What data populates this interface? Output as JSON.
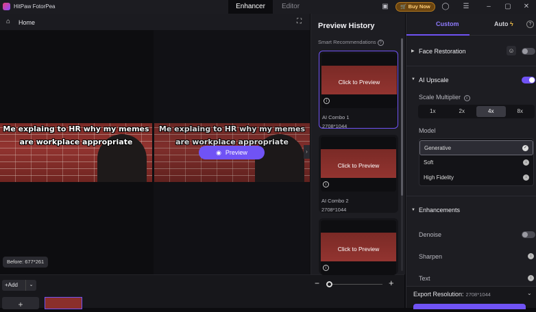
{
  "titlebar": {
    "app_name": "HitPaw FotorPea",
    "tabs": [
      "Enhancer",
      "Editor"
    ],
    "buy_now": "Buy Now",
    "icons": [
      "gift-icon",
      "user-icon",
      "menu-icon",
      "minimize-icon",
      "maximize-icon",
      "close-icon"
    ]
  },
  "home": {
    "label": "Home"
  },
  "canvas": {
    "meme_line1": "Me explaing to HR why my memes",
    "meme_line2": "are workplace appropriate",
    "preview_label": "Preview",
    "before_label": "Before: 677*261"
  },
  "bottom": {
    "add_label": "Add",
    "add_tile": "+"
  },
  "history": {
    "title": "Preview History",
    "smart_recommendations": "Smart Recommendations",
    "cards": [
      {
        "cta": "Click to Preview",
        "name": "AI Combo 1",
        "resolution": "2708*1044",
        "selected": true
      },
      {
        "cta": "Click to Preview",
        "name": "AI Combo 2",
        "resolution": "2708*1044",
        "selected": false
      },
      {
        "cta": "Click to Preview",
        "name": "",
        "resolution": "",
        "selected": false
      }
    ]
  },
  "panel": {
    "tab_custom": "Custom",
    "tab_auto": "Auto",
    "face_restoration": "Face Restoration",
    "ai_upscale": "AI Upscale",
    "scale_multiplier": "Scale Multiplier",
    "scale_options": [
      "1x",
      "2x",
      "4x",
      "8x"
    ],
    "scale_selected": "4x",
    "model_label": "Model",
    "models": [
      "Generative",
      "Soft",
      "High Fidelity"
    ],
    "model_selected": "Generative",
    "enhancements": "Enhancements",
    "denoise": "Denoise",
    "sharpen": "Sharpen",
    "text": "Text",
    "export_label": "Export Resolution:",
    "export_value": "2708*1044"
  },
  "colors": {
    "accent": "#7053f5",
    "buy_now": "#b57a1e",
    "background": "#0c0c0f",
    "panel": "#1d1d22"
  }
}
